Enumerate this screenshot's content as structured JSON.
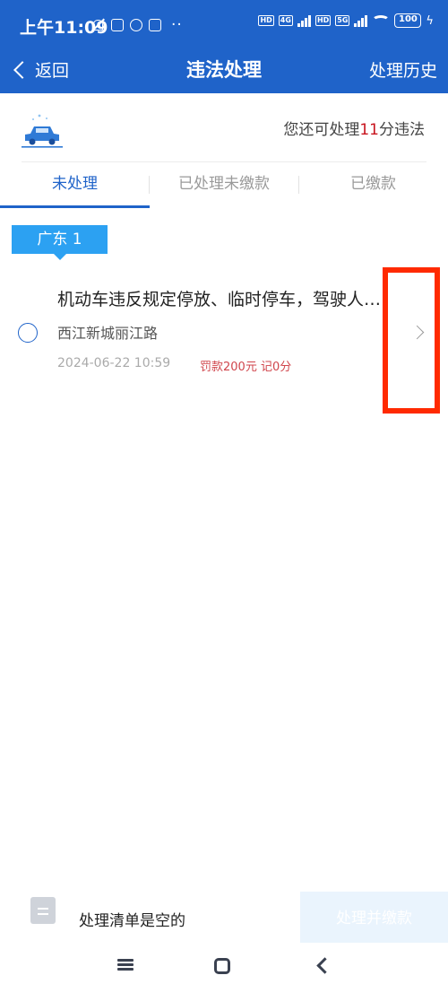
{
  "status_bar": {
    "time": "上午11:09",
    "dots": "··",
    "net1": "HD",
    "net2": "4G",
    "net3": "HD",
    "net4": "5G",
    "battery": "100"
  },
  "nav": {
    "back_label": "返回",
    "title": "违法处理",
    "history_label": "处理历史"
  },
  "quota": {
    "prefix": "您还可处理",
    "number": "11",
    "suffix": "分违法"
  },
  "tabs": [
    {
      "label": "未处理",
      "active": true
    },
    {
      "label": "已处理未缴款",
      "active": false
    },
    {
      "label": "已缴款",
      "active": false
    }
  ],
  "region_tag": "广东 1",
  "violation": {
    "title": "机动车违反规定停放、临时停车，驾驶人不在现场",
    "location": "西江新城丽江路",
    "datetime": "2024-06-22 10:59",
    "fine": "罚款200元 记0分"
  },
  "bottom": {
    "empty_text": "处理清单是空的",
    "submit_label": "处理并缴款"
  },
  "colors": {
    "brand": "#1f63c9",
    "tag": "#2ca1f2",
    "alert": "#c8141e",
    "highlight": "#ff2a00"
  }
}
